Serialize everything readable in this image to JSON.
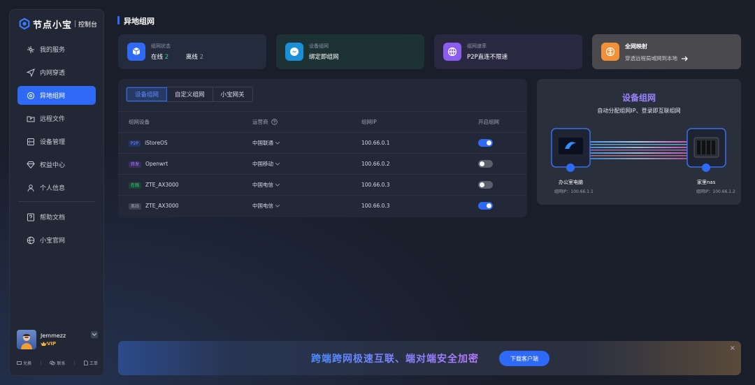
{
  "brand": {
    "name": "节点小宝",
    "console": "控制台"
  },
  "nav": [
    {
      "label": "我的服务",
      "icon": "services-icon"
    },
    {
      "label": "内网穿透",
      "icon": "send-icon"
    },
    {
      "label": "异地组网",
      "icon": "network-icon",
      "active": true
    },
    {
      "label": "远程文件",
      "icon": "folder-icon"
    },
    {
      "label": "设备管理",
      "icon": "device-icon"
    },
    {
      "label": "权益中心",
      "icon": "diamond-icon"
    },
    {
      "label": "个人信息",
      "icon": "user-icon"
    },
    {
      "label": "帮助文档",
      "icon": "help-icon"
    },
    {
      "label": "小宝官网",
      "icon": "globe-icon"
    }
  ],
  "user": {
    "name": "Jemmezz",
    "vip": "VIP",
    "actions": [
      "兑换",
      "联系",
      "工单"
    ]
  },
  "page_title": "异地组网",
  "cards": {
    "status": {
      "label": "组网状态",
      "online_label": "在线",
      "online_count": "2",
      "offline_label": "离线",
      "offline_count": "2"
    },
    "device": {
      "label": "设备组网",
      "value": "绑定即组网"
    },
    "speed": {
      "label": "组网速率",
      "value": "P2P直连不限速"
    },
    "mapping": {
      "label": "全网映射",
      "value": "穿透远程局域网到本地"
    }
  },
  "tabs": [
    "设备组网",
    "自定义组网",
    "小宝网关"
  ],
  "table": {
    "headers": [
      "组网设备",
      "运营商",
      "组网IP",
      "开启组网"
    ],
    "rows": [
      {
        "badge": "P2P",
        "device": "iStoreOS",
        "isp": "中国联通",
        "ip": "100.66.0.1",
        "enabled": true
      },
      {
        "badge": "转发",
        "device": "Openwrt",
        "isp": "中国移动",
        "ip": "100.66.0.2",
        "enabled": false
      },
      {
        "badge": "在线",
        "device": "ZTE_AX3000",
        "isp": "中国电信",
        "ip": "100.66.0.3",
        "enabled": false
      },
      {
        "badge": "离线",
        "device": "ZTE_AX3000",
        "isp": "中国电信",
        "ip": "100.66.0.3",
        "enabled": true
      }
    ]
  },
  "diagram": {
    "title": "设备组网",
    "subtitle": "自动分配组网IP、登录即互联组网",
    "left": {
      "name": "办公室电脑",
      "ip": "组网IP：100.66.1.1"
    },
    "right": {
      "name": "家里nas",
      "ip": "组网IP：100.66.1.2"
    }
  },
  "banner": {
    "text": "跨端跨网极速互联、端对端安全加密",
    "button": "下载客户端",
    "close": "×"
  },
  "colors": {
    "accent": "#2f6af6",
    "online": "#2fd39a",
    "title_purple": "#9a84ff"
  }
}
